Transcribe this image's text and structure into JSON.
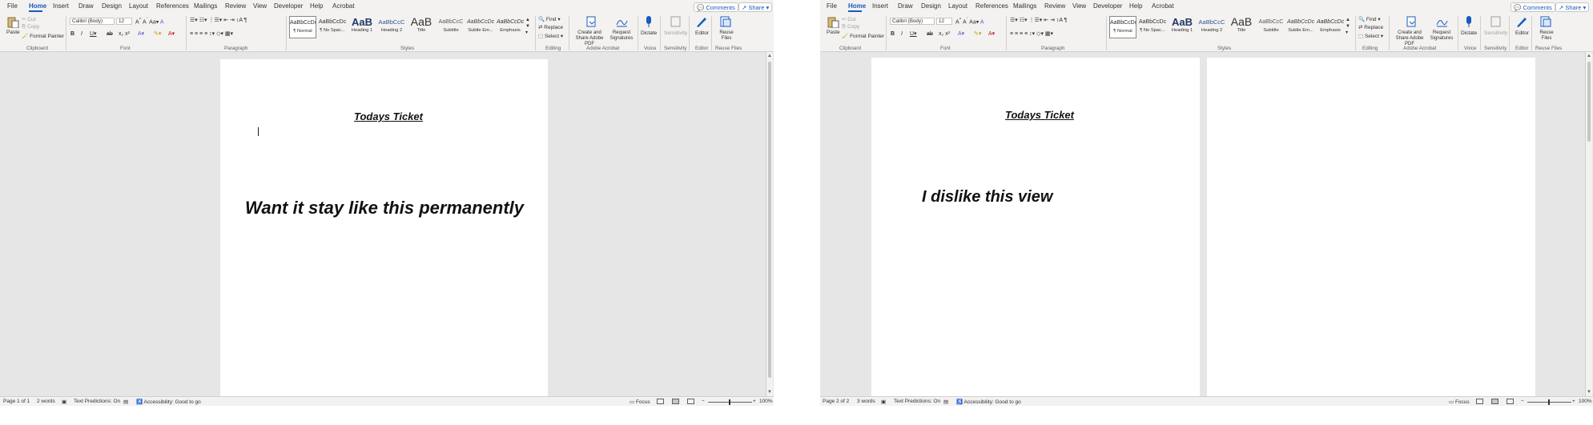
{
  "windows": {
    "left": {
      "menu_tabs": [
        "File",
        "Home",
        "Insert",
        "Draw",
        "Design",
        "Layout",
        "References",
        "Mailings",
        "Review",
        "View",
        "Developer",
        "Help",
        "Acrobat"
      ],
      "comments_label": "Comments",
      "share_label": "Share",
      "clipboard": {
        "paste": "Paste",
        "cut": "Cut",
        "copy": "Copy",
        "format_painter": "Format Painter",
        "group": "Clipboard"
      },
      "font": {
        "name": "Calibri (Body)",
        "size": "12",
        "group": "Font"
      },
      "paragraph_group": "Paragraph",
      "styles": {
        "items": [
          {
            "preview": "AaBbCcDc",
            "name": "¶ Normal"
          },
          {
            "preview": "AaBbCcDc",
            "name": "¶ No Spac..."
          },
          {
            "preview": "AaB",
            "name": "Heading 1"
          },
          {
            "preview": "AaBbCcC",
            "name": "Heading 2"
          },
          {
            "preview": "AaB",
            "name": "Title"
          },
          {
            "preview": "AaBbCcC",
            "name": "Subtitle"
          },
          {
            "preview": "AaBbCcDc",
            "name": "Subtle Em..."
          },
          {
            "preview": "AaBbCcDc",
            "name": "Emphasis"
          }
        ],
        "group": "Styles"
      },
      "editing": {
        "find": "Find",
        "replace": "Replace",
        "select": "Select",
        "group": "Editing"
      },
      "acrobat": {
        "create": "Create and Share Adobe PDF",
        "request": "Request Signatures",
        "group": "Adobe Acrobat"
      },
      "voice": {
        "dictate": "Dictate",
        "group": "Voice"
      },
      "sensitivity": {
        "label": "Sensitivity",
        "group": "Sensitivity"
      },
      "editor": {
        "label": "Editor",
        "group": "Editor"
      },
      "reuse": {
        "label": "Reuse Files",
        "group": "Reuse Files"
      },
      "document": {
        "title": "Todays Ticket",
        "body": "Want it stay like this permanently"
      },
      "status": {
        "page": "Page 1 of 1",
        "words": "2 words",
        "predictions": "Text Predictions: On",
        "accessibility": "Accessibility: Good to go",
        "focus": "Focus",
        "zoom": "100%"
      }
    },
    "right": {
      "menu_tabs": [
        "File",
        "Home",
        "Insert",
        "Draw",
        "Design",
        "Layout",
        "References",
        "Mailings",
        "Review",
        "View",
        "Developer",
        "Help",
        "Acrobat"
      ],
      "comments_label": "Comments",
      "share_label": "Share",
      "clipboard": {
        "paste": "Paste",
        "cut": "Cut",
        "copy": "Copy",
        "format_painter": "Format Painter",
        "group": "Clipboard"
      },
      "font": {
        "name": "Calibri (Body)",
        "size": "12",
        "group": "Font"
      },
      "paragraph_group": "Paragraph",
      "styles": {
        "items": [
          {
            "preview": "AaBbCcDc",
            "name": "¶ Normal"
          },
          {
            "preview": "AaBbCcDc",
            "name": "¶ No Spac..."
          },
          {
            "preview": "AaB",
            "name": "Heading 1"
          },
          {
            "preview": "AaBbCcC",
            "name": "Heading 2"
          },
          {
            "preview": "AaB",
            "name": "Title"
          },
          {
            "preview": "AaBbCcC",
            "name": "Subtitle"
          },
          {
            "preview": "AaBbCcDc",
            "name": "Subtle Em..."
          },
          {
            "preview": "AaBbCcDc",
            "name": "Emphasis"
          }
        ],
        "group": "Styles"
      },
      "editing": {
        "find": "Find",
        "replace": "Replace",
        "select": "Select",
        "group": "Editing"
      },
      "acrobat": {
        "create": "Create and Share Adobe PDF",
        "request": "Request Signatures",
        "group": "Adobe Acrobat"
      },
      "voice": {
        "dictate": "Dictate",
        "group": "Voice"
      },
      "sensitivity": {
        "label": "Sensitivity",
        "group": "Sensitivity"
      },
      "editor": {
        "label": "Editor",
        "group": "Editor"
      },
      "reuse": {
        "label": "Reuse Files",
        "group": "Reuse Files"
      },
      "document": {
        "title": "Todays Ticket",
        "body": "I dislike this view"
      },
      "status": {
        "page": "Page 2 of 2",
        "words": "3 words",
        "predictions": "Text Predictions: On",
        "accessibility": "Accessibility: Good to go",
        "focus": "Focus",
        "zoom": "100%"
      }
    }
  },
  "colors": {
    "accent": "#185abd",
    "ribbon_bg": "#f3f2f1",
    "canvas_bg": "#e6e6e6"
  }
}
